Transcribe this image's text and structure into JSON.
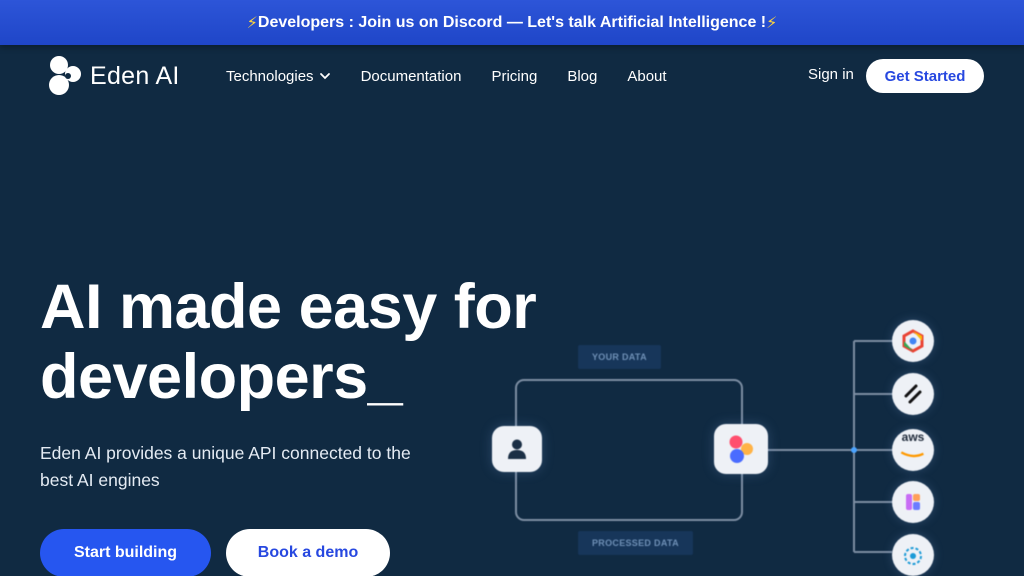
{
  "banner": {
    "text": "Developers : Join us on Discord — Let's talk Artificial Intelligence !"
  },
  "nav": {
    "brand": "Eden AI",
    "links": [
      "Technologies",
      "Documentation",
      "Pricing",
      "Blog",
      "About"
    ],
    "signin": "Sign in",
    "get_started": "Get Started"
  },
  "hero": {
    "title_line1": "AI made easy for",
    "title_line2": "developers_",
    "subtitle": "Eden AI provides a unique API connected to the best AI engines",
    "start_button": "Start building",
    "demo_button": "Book a demo"
  },
  "diagram": {
    "top_label": "YOUR DATA",
    "bottom_label": "PROCESSED DATA",
    "providers": [
      "google-cloud-icon",
      "pipe-provider-icon",
      "aws-icon",
      "microsoft-icon",
      "ibm-icon"
    ],
    "aws_label": "aws"
  },
  "colors": {
    "background": "#102a42",
    "banner": "#2550d8",
    "accent": "#2656f0",
    "white": "#ffffff"
  }
}
